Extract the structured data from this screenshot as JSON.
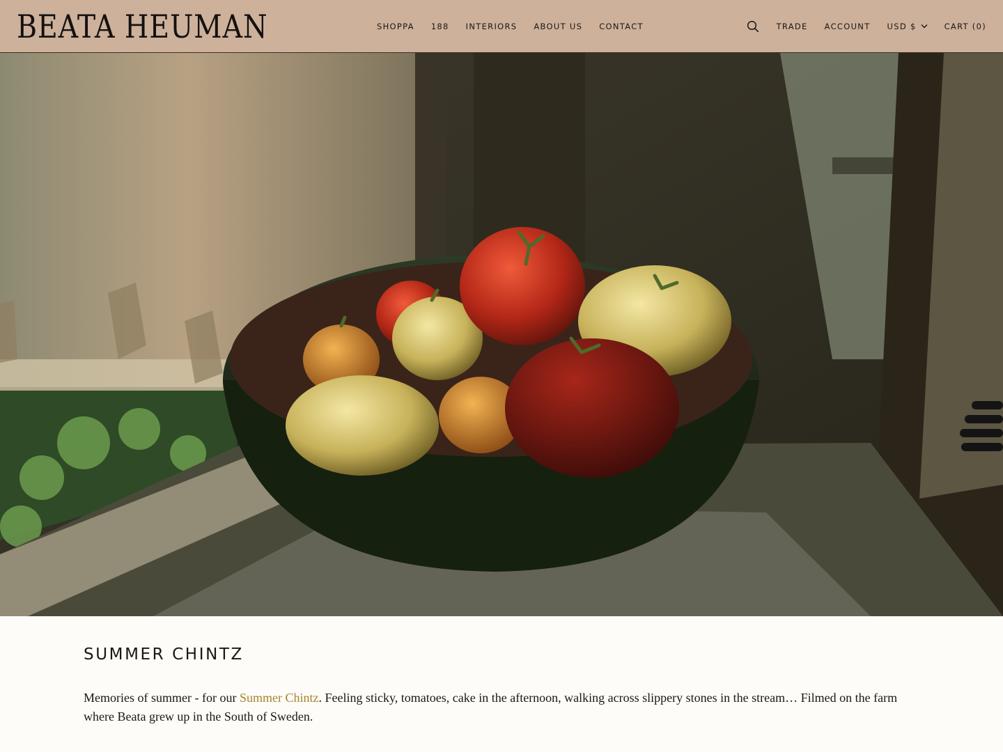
{
  "brand": {
    "logo_text": "BEATA HEUMAN"
  },
  "nav": {
    "main": [
      "SHOPPA",
      "188",
      "INTERIORS",
      "ABOUT US",
      "CONTACT"
    ],
    "search_icon": "search-icon",
    "trade": "TRADE",
    "account": "ACCOUNT",
    "currency": "USD $",
    "cart": "CART (0)"
  },
  "hero": {
    "kind": "video-still",
    "subject": "bowl of heirloom tomatoes on a windowsill"
  },
  "article": {
    "title": "SUMMER CHINTZ",
    "desc_before": "Memories of summer - for our ",
    "desc_link": "Summer Chintz",
    "desc_after": ". Feeling sticky, tomatoes, cake in the afternoon, walking across slippery stones in the stream… Filmed on the farm where Beata grew up in the South of Sweden."
  },
  "colors": {
    "header_bg": "#cdb19b",
    "page_bg": "#fdfcf8",
    "text": "#1c1714",
    "link": "#a8842c"
  }
}
